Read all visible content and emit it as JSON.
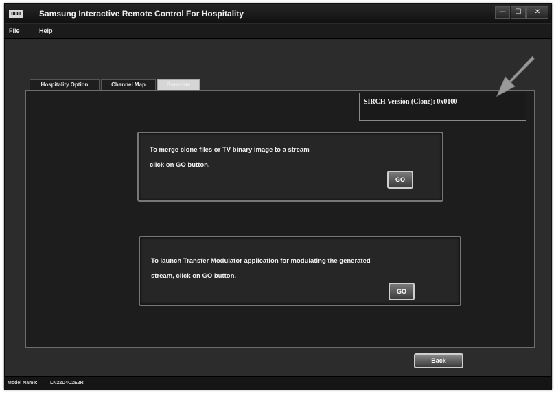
{
  "window": {
    "logo_text": "IIIIIII",
    "title": "Samsung Interactive Remote Control For Hospitality",
    "controls": {
      "minimize": "—",
      "maximize": "☐",
      "close": "✕"
    }
  },
  "menu": {
    "file": "File",
    "help": "Help"
  },
  "tabs": [
    {
      "label": "Hospitality Option",
      "selected": false
    },
    {
      "label": "Channel Map",
      "selected": false
    },
    {
      "label": "Generate",
      "selected": true
    }
  ],
  "version": {
    "text": "SIRCH Version (Clone): 0x0100"
  },
  "actions": [
    {
      "line1": "To merge clone files or TV binary image to a stream",
      "line2": "click on GO button.",
      "button": "GO"
    },
    {
      "line1": "To launch Transfer Modulator application for modulating the generated",
      "line2": "stream, click on GO button.",
      "button": "GO"
    }
  ],
  "footer": {
    "back_label": "Back"
  },
  "status": {
    "model_label": "Model Name:",
    "model_value": "LN22D4C2E2R"
  },
  "colors": {
    "window_bg": "#2b2b2b",
    "panel_bg": "#1d1d1d",
    "arrow": "#9a9a9a"
  },
  "icons": {
    "pointer": "pointer-arrow-icon"
  }
}
